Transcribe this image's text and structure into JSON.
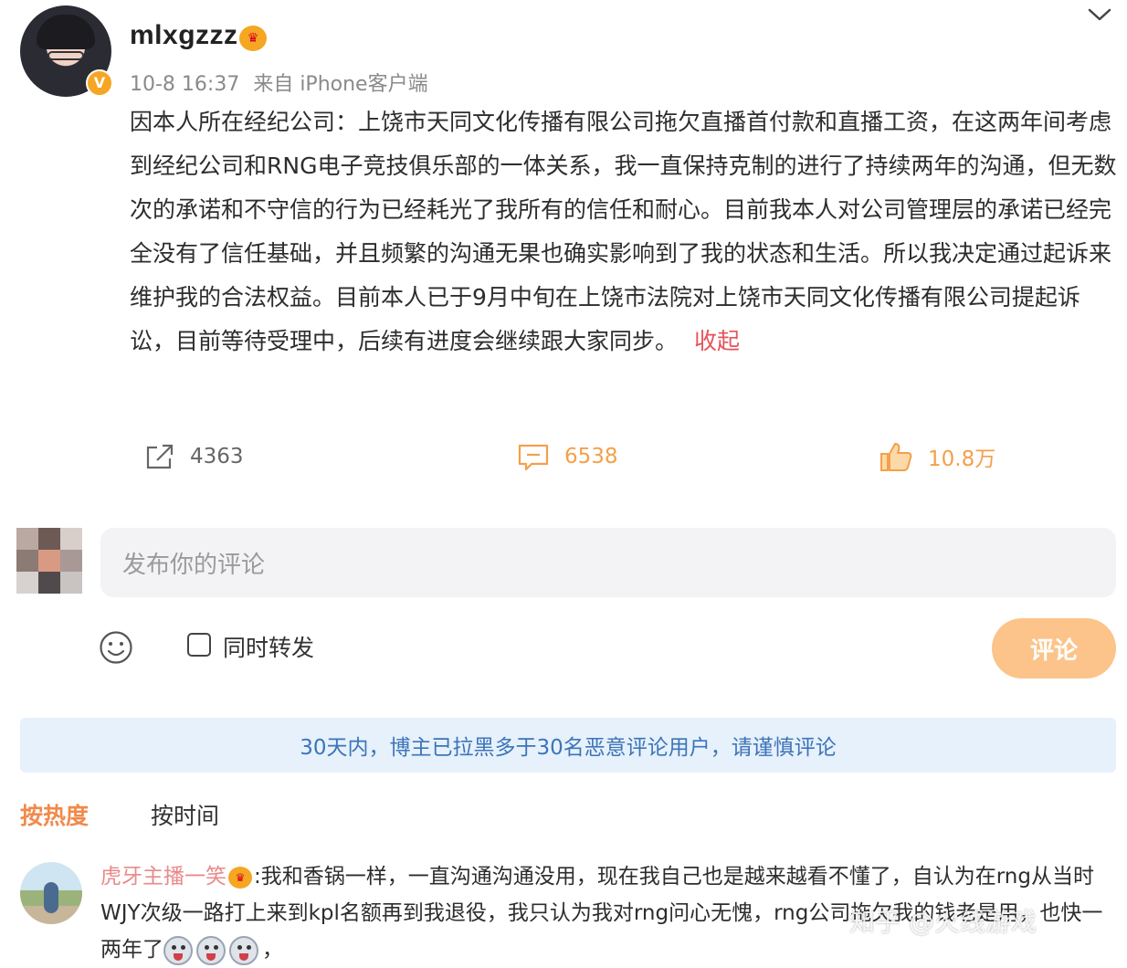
{
  "post": {
    "username": "mlxgzzz",
    "verified_badge": "V",
    "crown_badge": "crown-badge-icon",
    "time": "10-8 16:37",
    "source": "来自 iPhone客户端",
    "body": "因本人所在经纪公司：上饶市天同文化传播有限公司拖欠直播首付款和直播工资，在这两年间考虑到经纪公司和RNG电子竞技俱乐部的一体关系，我一直保持克制的进行了持续两年的沟通，但无数次的承诺和不守信的行为已经耗光了我所有的信任和耐心。目前我本人对公司管理层的承诺已经完全没有了信任基础，并且频繁的沟通无果也确实影响到了我的状态和生活。所以我决定通过起诉来维护我的合法权益。目前本人已于9月中旬在上饶市法院对上饶市天同文化传播有限公司提起诉讼，目前等待受理中，后续有进度会继续跟大家同步。",
    "collapse_label": "收起"
  },
  "actions": {
    "share_count": "4363",
    "comment_count": "6538",
    "like_count": "10.8万"
  },
  "composer": {
    "placeholder": "发布你的评论",
    "repost_label": "同时转发",
    "submit_label": "评论"
  },
  "notice": "30天内，博主已拉黑多于30名恶意评论用户，请谨慎评论",
  "sort": {
    "hot": "按热度",
    "time": "按时间"
  },
  "comment": {
    "user": "虎牙主播一笑",
    "text_1": ":我和香锅一样，一直沟通沟通没用，现在我自己也是越来越看不懂了，自认为在rng从当时WJY次级一路打上来到kpl名额再到我退役，我只认为我对rng问心无愧，rng公司拖欠我的钱老是",
    "text_2": "用，也快一两年了",
    "text_end": "，"
  },
  "watermark": "知乎 @火线游戏",
  "colors": {
    "accent_orange": "#f4a04a",
    "notice_bg": "#e6f1fb",
    "notice_text": "#3d74b8",
    "collapse_red": "#e5535b"
  }
}
